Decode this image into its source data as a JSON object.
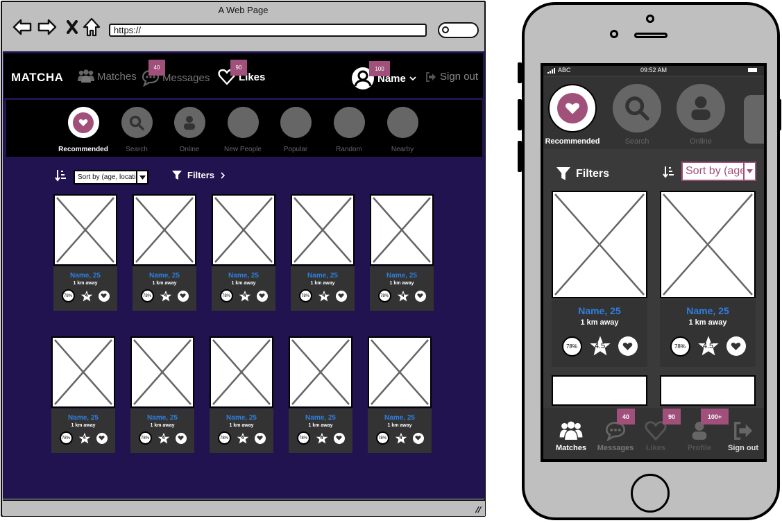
{
  "browser": {
    "title": "A Web Page",
    "url": "https://",
    "nav_icons": [
      "back-arrow-icon",
      "forward-arrow-icon",
      "close-icon",
      "home-icon"
    ]
  },
  "desktop": {
    "logo": "MATCHA",
    "nav": {
      "matches": {
        "label": "Matches",
        "icon": "users-icon"
      },
      "messages": {
        "label": "Messages",
        "icon": "chat-bubble-icon",
        "badge": "40"
      },
      "likes": {
        "label": "Likes",
        "icon": "heart-outline-icon",
        "badge": "90"
      },
      "profile": {
        "label": "Name",
        "icon": "user-avatar-icon",
        "badge": "100"
      },
      "signout": {
        "label": "Sign out",
        "icon": "sign-out-icon"
      }
    },
    "categories": [
      {
        "label": "Recommended",
        "icon": "heart-icon",
        "active": true
      },
      {
        "label": "Search",
        "icon": "search-icon",
        "active": false
      },
      {
        "label": "Online",
        "icon": "user-icon",
        "active": false
      },
      {
        "label": "New People",
        "icon": "",
        "active": false
      },
      {
        "label": "Popular",
        "icon": "",
        "active": false
      },
      {
        "label": "Random",
        "icon": "",
        "active": false
      },
      {
        "label": "Nearby",
        "icon": "",
        "active": false
      }
    ],
    "sort": {
      "selected": "Sort by (age, location...)",
      "visible_text": "Sort by (age, locati"
    },
    "filters_label": "Filters",
    "profiles": [
      {
        "name": "Name, 25",
        "distance": "1 km away",
        "match": "78%",
        "rating": "4"
      },
      {
        "name": "Name, 25",
        "distance": "1 km away",
        "match": "78%",
        "rating": "4"
      },
      {
        "name": "Name, 25",
        "distance": "1 km away",
        "match": "78%",
        "rating": "4"
      },
      {
        "name": "Name, 25",
        "distance": "1 km away",
        "match": "78%",
        "rating": "4"
      },
      {
        "name": "Name, 25",
        "distance": "1 km away",
        "match": "78%",
        "rating": "4"
      },
      {
        "name": "Name, 25",
        "distance": "1 km away",
        "match": "78%",
        "rating": "4"
      },
      {
        "name": "Name, 25",
        "distance": "1 km away",
        "match": "78%",
        "rating": "4"
      },
      {
        "name": "Name, 25",
        "distance": "1 km away",
        "match": "78%",
        "rating": "4"
      },
      {
        "name": "Name, 25",
        "distance": "1 km away",
        "match": "78%",
        "rating": "4"
      },
      {
        "name": "Name, 25",
        "distance": "1 km away",
        "match": "78%",
        "rating": "4"
      }
    ]
  },
  "mobile": {
    "status": {
      "carrier": "ABC",
      "time": "09:52 AM"
    },
    "categories": [
      {
        "label": "Recommended",
        "icon": "heart-icon",
        "active": true
      },
      {
        "label": "Search",
        "icon": "search-icon",
        "active": false
      },
      {
        "label": "Online",
        "icon": "user-icon",
        "active": false
      }
    ],
    "filters_label": "Filters",
    "sort": {
      "selected": "Sort by (age, location...)",
      "visible_text": "Sort by (age"
    },
    "profiles": [
      {
        "name": "Name, 25",
        "distance": "1 km away",
        "match": "78%",
        "rating": "4.5"
      },
      {
        "name": "Name, 25",
        "distance": "1 km away",
        "match": "78%",
        "rating": "4.5"
      }
    ],
    "tabs": [
      {
        "label": "Matches",
        "icon": "users-icon",
        "active": true,
        "badge": ""
      },
      {
        "label": "Messages",
        "icon": "chat-bubble-icon",
        "active": false,
        "badge": "40"
      },
      {
        "label": "Likes",
        "icon": "heart-outline-icon",
        "active": false,
        "badge": "90"
      },
      {
        "label": "Profile",
        "icon": "user-icon",
        "active": false,
        "badge": "100+"
      },
      {
        "label": "Sign out",
        "icon": "sign-out-icon",
        "active": false,
        "badge": ""
      }
    ]
  },
  "colors": {
    "brand_accent": "#a0507a",
    "page_background": "#20134f",
    "name_link": "#2f7fe0",
    "card_panel": "#333333"
  }
}
